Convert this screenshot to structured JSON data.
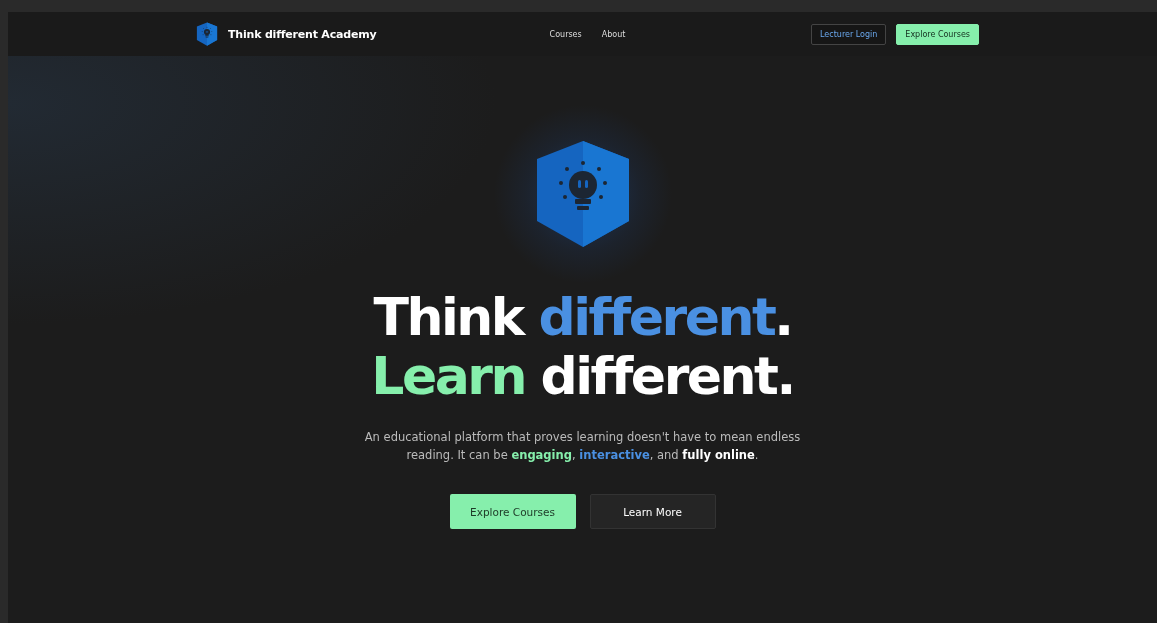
{
  "nav": {
    "brand": "Think different Academy",
    "links": [
      {
        "label": "Courses"
      },
      {
        "label": "About"
      }
    ],
    "buttons": [
      {
        "label": "Lecturer Login",
        "kind": "outline"
      },
      {
        "label": "Explore Courses",
        "kind": "primary"
      }
    ]
  },
  "hero": {
    "headline": [
      [
        {
          "text": "Think ",
          "kind": "plain"
        },
        {
          "text": "different",
          "kind": "blue"
        },
        {
          "text": ".",
          "kind": "plain"
        }
      ],
      [
        {
          "text": "Learn",
          "kind": "green"
        },
        {
          "text": " different.",
          "kind": "plain"
        }
      ]
    ],
    "description": [
      {
        "text": "An educational platform that proves learning doesn't have to mean endless reading. It can be ",
        "kind": "plain"
      },
      {
        "text": "engaging",
        "kind": "green"
      },
      {
        "text": ", ",
        "kind": "plain"
      },
      {
        "text": "interactive",
        "kind": "blue"
      },
      {
        "text": ", and ",
        "kind": "plain"
      },
      {
        "text": "fully online",
        "kind": "strong"
      },
      {
        "text": ".",
        "kind": "plain"
      }
    ],
    "buttons": [
      {
        "label": "Explore Courses",
        "kind": "primary"
      },
      {
        "label": "Learn More",
        "kind": "dark"
      }
    ]
  }
}
